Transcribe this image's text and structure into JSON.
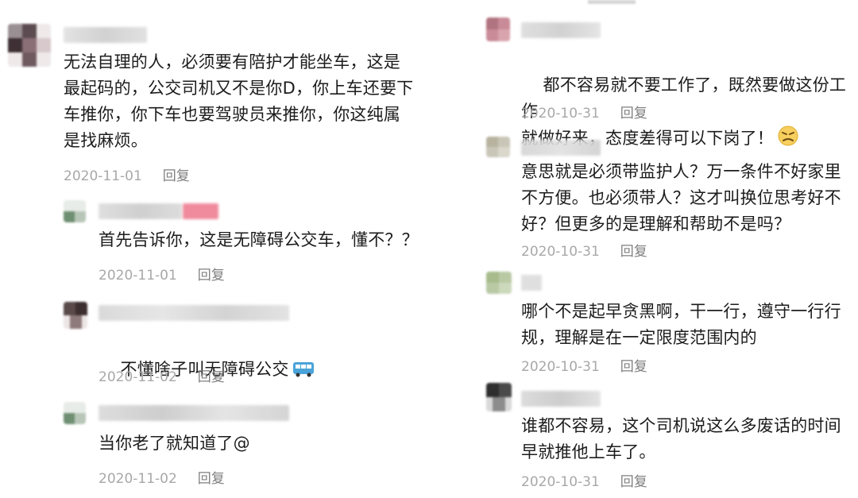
{
  "left_column": {
    "comments": [
      {
        "text": "无法自理的人，必须要有陪护才能坐车，这是\n最起码的，公交司机又不是你D，你上车还要下\n车推你，你下车也要驾驶员来推你，你这纯属\n是找麻烦。",
        "date": "2020-11-01",
        "reply": "回复"
      },
      {
        "text": "首先告诉你，这是无障碍公交车，懂不？？",
        "date": "2020-11-01",
        "reply": "回复"
      },
      {
        "text": "不懂啥子叫无障碍公交",
        "emoji": "bus-emoji",
        "date": "2020-11-02",
        "reply": "回复"
      },
      {
        "text": "当你老了就知道了@",
        "date": "2020-11-02",
        "reply": "回复"
      }
    ]
  },
  "right_column": {
    "comments": [
      {
        "text": "都不容易就不要工作了，既然要做这份工作\n就做好来，态度差得可以下岗了！",
        "emoji": "angry-face-emoji",
        "date": "2020-10-31",
        "reply": "回复"
      },
      {
        "text": "意思就是必须带监护人？万一条件不好家里\n不方便。也必须带人？这才叫换位思考好不\n好？但更多的是理解和帮助不是吗？",
        "date": "2020-10-31",
        "reply": "回复"
      },
      {
        "text": "哪个不是起早贪黑啊，干一行，遵守一行行\n规，理解是在一定限度范围内的",
        "date": "2020-10-31",
        "reply": "回复"
      },
      {
        "text": "谁都不容易，这个司机说这么多废话的时间\n早就推他上车了。",
        "date": "2020-10-31",
        "reply": "回复"
      }
    ]
  },
  "colors": {
    "text": "#1c1c1c",
    "date": "#a8a8a8",
    "reply": "#7f7f7f",
    "blur_gray": "#d4d4d4",
    "blur_pink": "#ee7f93"
  }
}
